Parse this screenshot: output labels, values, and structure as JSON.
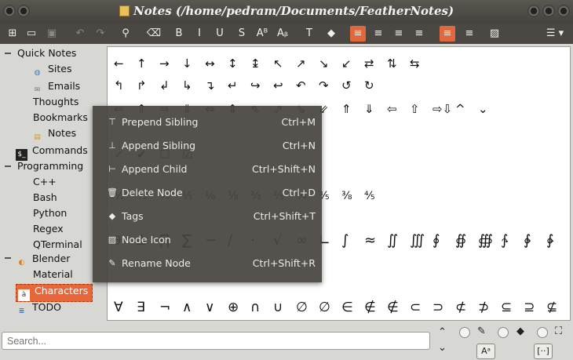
{
  "window": {
    "title": "Notes (/home/pedram/Documents/FeatherNotes)"
  },
  "toolbar": {
    "buttons": [
      {
        "name": "new-note-icon",
        "glyph": "⊞"
      },
      {
        "name": "open-icon",
        "glyph": "▭"
      },
      {
        "name": "save-icon",
        "glyph": "▣"
      },
      {
        "name": "undo-icon",
        "glyph": "↶"
      },
      {
        "name": "redo-icon",
        "glyph": "↷"
      },
      {
        "name": "find-icon",
        "glyph": "⚲"
      },
      {
        "name": "clear-format-icon",
        "glyph": "⌫"
      },
      {
        "name": "bold-icon",
        "glyph": "B"
      },
      {
        "name": "italic-icon",
        "glyph": "I"
      },
      {
        "name": "underline-icon",
        "glyph": "U"
      },
      {
        "name": "strikethrough-icon",
        "glyph": "S"
      },
      {
        "name": "superscript-icon",
        "glyph": "Aᴮ"
      },
      {
        "name": "subscript-icon",
        "glyph": "Aᵦ"
      },
      {
        "name": "text-color-icon",
        "glyph": "T"
      },
      {
        "name": "background-color-icon",
        "glyph": "◆"
      },
      {
        "name": "align-left-icon",
        "glyph": "≡"
      },
      {
        "name": "align-center-icon",
        "glyph": "≡"
      },
      {
        "name": "align-right-icon",
        "glyph": "≡"
      },
      {
        "name": "justify-icon",
        "glyph": "≡"
      },
      {
        "name": "ltr-icon",
        "glyph": "≡"
      },
      {
        "name": "rtl-icon",
        "glyph": "≡"
      },
      {
        "name": "image-icon",
        "glyph": "▨"
      },
      {
        "name": "menu-icon",
        "glyph": "☰ ▾"
      }
    ]
  },
  "tree": {
    "items": [
      {
        "label": "Quick Notes",
        "icon": "",
        "level": 0
      },
      {
        "label": "Sites",
        "icon": "globe-icon",
        "level": 1
      },
      {
        "label": "Emails",
        "icon": "mail-icon",
        "level": 1
      },
      {
        "label": "Thoughts",
        "icon": "",
        "level": 1
      },
      {
        "label": "Bookmarks",
        "icon": "",
        "level": 1
      },
      {
        "label": "Notes",
        "icon": "note-icon",
        "level": 1
      },
      {
        "label": "Commands",
        "icon": "terminal-icon",
        "level": 0
      },
      {
        "label": "Programming",
        "icon": "",
        "level": 0
      },
      {
        "label": "C++",
        "icon": "",
        "level": 1
      },
      {
        "label": "Bash",
        "icon": "",
        "level": 1
      },
      {
        "label": "Python",
        "icon": "",
        "level": 1
      },
      {
        "label": "Regex",
        "icon": "",
        "level": 1
      },
      {
        "label": "QTerminal",
        "icon": "",
        "level": 1
      },
      {
        "label": "Blender",
        "icon": "blender-icon",
        "level": 0
      },
      {
        "label": "Material",
        "icon": "",
        "level": 1
      },
      {
        "label": "Characters",
        "icon": "char-icon",
        "level": 0,
        "selected": true
      },
      {
        "label": "TODO",
        "icon": "list-icon",
        "level": 0
      }
    ]
  },
  "editor": {
    "rows": [
      [
        "←",
        "↑",
        "→",
        "↓",
        "↔",
        "↕",
        "↨",
        "↖",
        "↗",
        "↘",
        "↙",
        "⇄",
        "⇅",
        "⇆"
      ],
      [
        "↰",
        "↱",
        "↲",
        "↳",
        "↴",
        "↵",
        "↪",
        "↩",
        "↶",
        "↷",
        "↺",
        "↻"
      ],
      [
        "⇐",
        "⇑",
        "⇒",
        "⇓",
        "⇔",
        "⇕",
        "⇖",
        "⇗",
        "⇘",
        "⇙",
        "⇑",
        "⇓",
        "⇦",
        "⇧",
        "⇨⇩",
        "^",
        "⌄"
      ],
      [
        "✓",
        "✔",
        "☐",
        "☑"
      ],
      [
        "½",
        "⅓",
        "¼",
        "⅕",
        "⅙",
        "⅛",
        "⅔",
        "⅖",
        "¾",
        "⅗",
        "⅜",
        "⅘"
      ],
      [
        "∂",
        "∆",
        "∏",
        "∑",
        "−",
        "/",
        "·",
        "√",
        "∞",
        "∟",
        "∫",
        "≈",
        "∬",
        "∭",
        "∮",
        "∯",
        "∰",
        "∱",
        "∲",
        "∳",
        "≠",
        "≤",
        "≥"
      ],
      [
        "∀",
        "∃",
        "¬",
        "∧",
        "∨",
        "⊕",
        "∩",
        "∪",
        "∅",
        "∅",
        "∈",
        "∉",
        "∉",
        "⊂",
        "⊃",
        "⊄",
        "⊅",
        "⊆",
        "⊇",
        "⊈"
      ]
    ]
  },
  "context_menu": {
    "items": [
      {
        "label": "Prepend Sibling",
        "shortcut": "Ctrl+M",
        "icon": "prepend-icon",
        "glyph": "⊤"
      },
      {
        "label": "Append Sibling",
        "shortcut": "Ctrl+N",
        "icon": "append-icon",
        "glyph": "⊥"
      },
      {
        "label": "Append Child",
        "shortcut": "Ctrl+Shift+N",
        "icon": "child-icon",
        "glyph": "⊢"
      },
      {
        "label": "Delete Node",
        "shortcut": "Ctrl+D",
        "icon": "trash-icon",
        "glyph": "🗑"
      },
      {
        "label": "Tags",
        "shortcut": "Ctrl+Shift+T",
        "icon": "tag-icon",
        "glyph": "◆"
      },
      {
        "label": "Node Icon",
        "shortcut": "",
        "icon": "image-icon",
        "glyph": "▨"
      },
      {
        "label": "Rename Node",
        "shortcut": "Ctrl+Shift+R",
        "icon": "pencil-icon",
        "glyph": "✎"
      }
    ]
  },
  "search": {
    "placeholder": "Search..."
  },
  "colors": {
    "accent": "#e0683c",
    "titlebar": "#4b4843",
    "menu": "#48443e"
  }
}
